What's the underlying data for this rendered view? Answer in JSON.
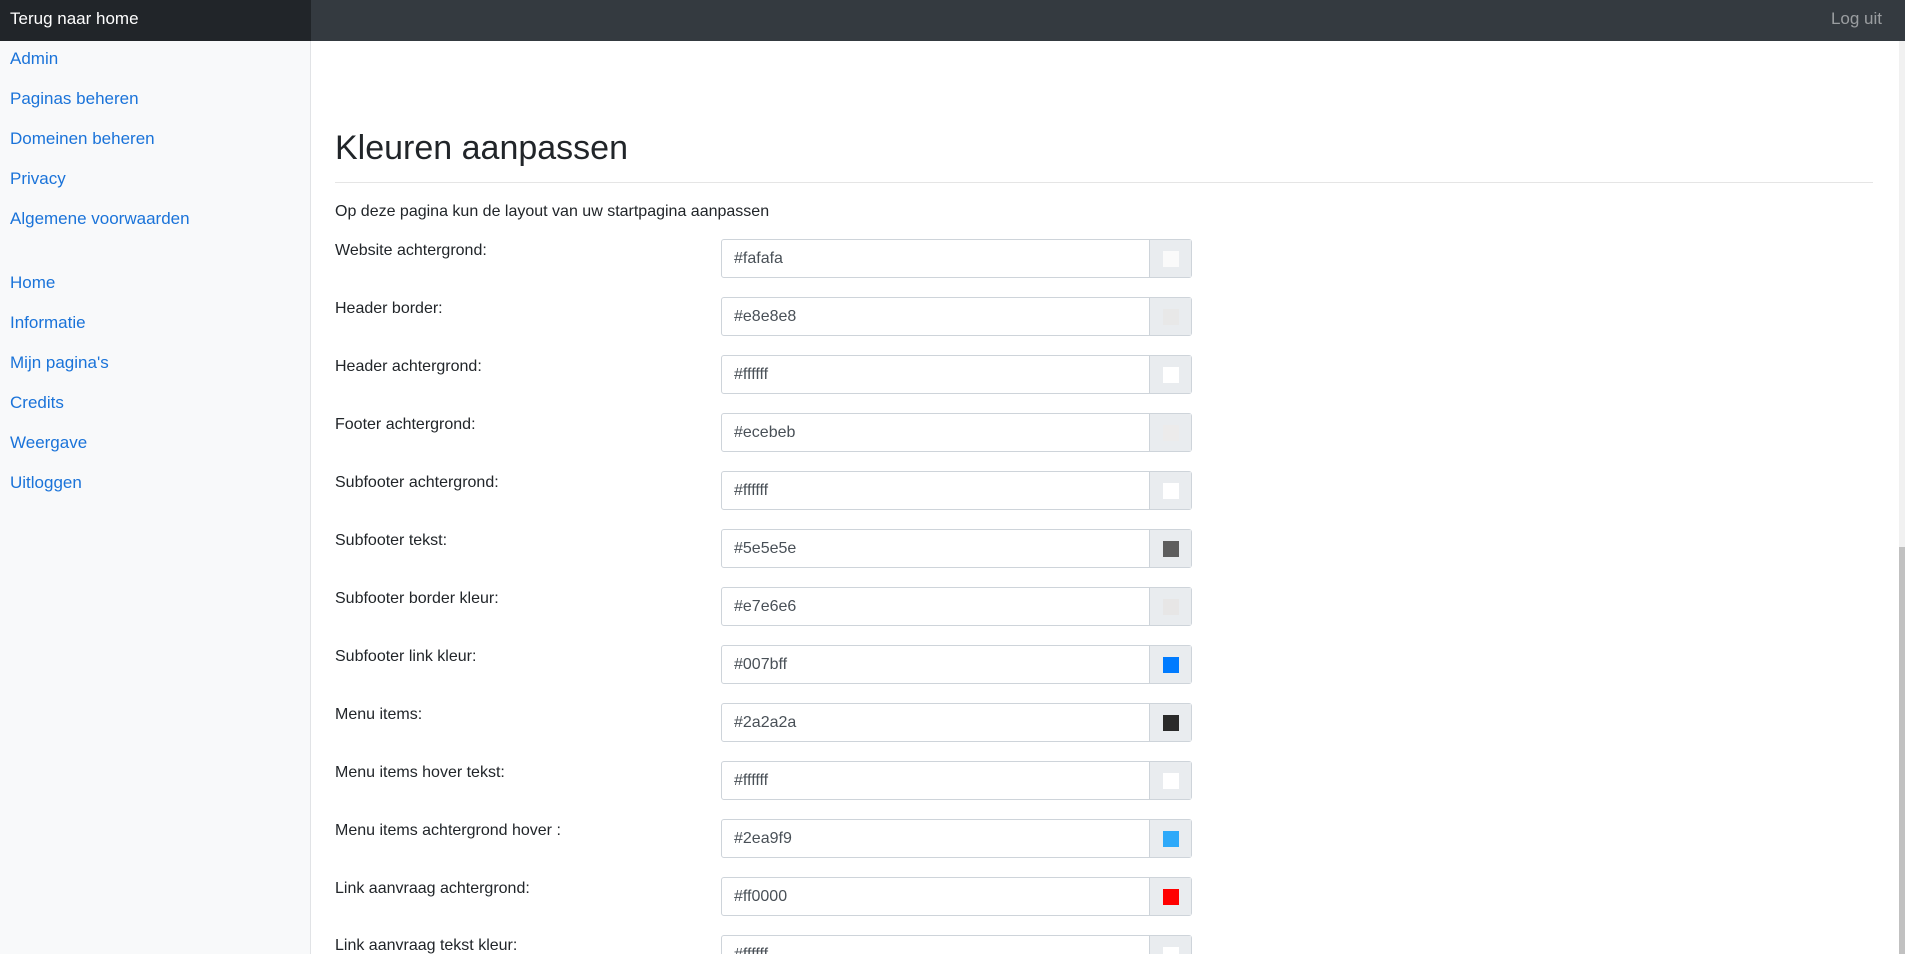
{
  "topbar": {
    "brand": "Terug naar home",
    "logout": "Log uit"
  },
  "sidebar": {
    "group1": [
      "Admin",
      "Paginas beheren",
      "Domeinen beheren",
      "Privacy",
      "Algemene voorwaarden"
    ],
    "group2": [
      "Home",
      "Informatie",
      "Mijn pagina's",
      "Credits",
      "Weergave",
      "Uitloggen"
    ]
  },
  "main": {
    "title": "Kleuren aanpassen",
    "intro": "Op deze pagina kun de layout van uw startpagina aanpassen",
    "fields": [
      {
        "label": "Website achtergrond:",
        "value": "#fafafa"
      },
      {
        "label": "Header border:",
        "value": "#e8e8e8"
      },
      {
        "label": "Header achtergrond:",
        "value": "#ffffff"
      },
      {
        "label": "Footer achtergrond:",
        "value": "#ecebeb"
      },
      {
        "label": "Subfooter achtergrond:",
        "value": "#ffffff"
      },
      {
        "label": "Subfooter tekst:",
        "value": "#5e5e5e"
      },
      {
        "label": "Subfooter border kleur:",
        "value": "#e7e6e6"
      },
      {
        "label": "Subfooter link kleur:",
        "value": "#007bff"
      },
      {
        "label": "Menu items:",
        "value": "#2a2a2a"
      },
      {
        "label": "Menu items hover tekst:",
        "value": "#ffffff"
      },
      {
        "label": "Menu items achtergrond hover :",
        "value": "#2ea9f9"
      },
      {
        "label": "Link aanvraag achtergrond:",
        "value": "#ff0000"
      },
      {
        "label": "Link aanvraag tekst kleur:",
        "value": "#ffffff"
      }
    ]
  },
  "colors": {
    "topbar": "#343a40",
    "brand_bg": "#212529",
    "link": "#1a73d9",
    "sidebar_bg": "#f8f9fa"
  }
}
